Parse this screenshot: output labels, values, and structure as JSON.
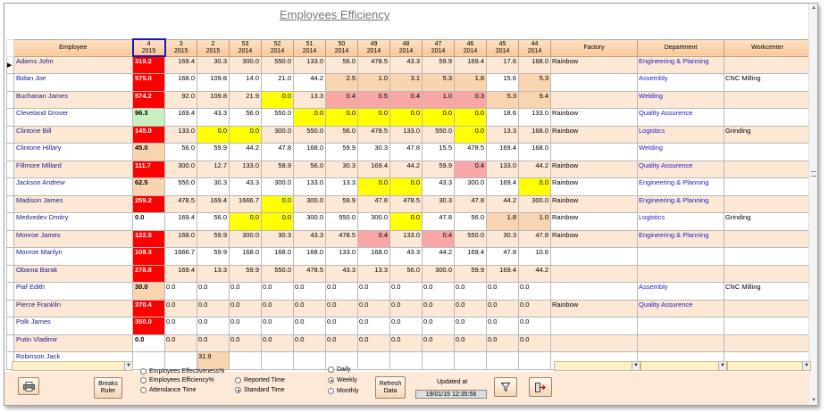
{
  "title": "Employees Efficiency",
  "columns": {
    "employee": "Employee",
    "weeks": [
      {
        "week": "4",
        "year": "2015"
      },
      {
        "week": "3",
        "year": "2015"
      },
      {
        "week": "2",
        "year": "2015"
      },
      {
        "week": "53",
        "year": "2014"
      },
      {
        "week": "52",
        "year": "2014"
      },
      {
        "week": "51",
        "year": "2014"
      },
      {
        "week": "50",
        "year": "2014"
      },
      {
        "week": "49",
        "year": "2014"
      },
      {
        "week": "48",
        "year": "2014"
      },
      {
        "week": "47",
        "year": "2014"
      },
      {
        "week": "46",
        "year": "2014"
      },
      {
        "week": "45",
        "year": "2014"
      },
      {
        "week": "44",
        "year": "2014"
      }
    ],
    "factory": "Factory",
    "department": "Department",
    "workcenter": "Workcenter"
  },
  "rows": [
    {
      "name": "Adams John",
      "v": [
        "319.2",
        "169.4",
        "30.3",
        "300.0",
        "550.0",
        "133.0",
        "56.0",
        "478.5",
        "43.3",
        "59.9",
        "169.4",
        "17.6",
        "168.0"
      ],
      "c": [
        "red",
        "",
        "",
        "",
        "",
        "",
        "",
        "",
        "",
        "",
        "",
        "",
        ""
      ],
      "factory": "Rainbow",
      "department": "Engineering & Planning",
      "workcenter": ""
    },
    {
      "name": "Bidan Joe",
      "v": [
        "575.0",
        "168.0",
        "109.8",
        "14.0",
        "21.0",
        "44.2",
        "2.5",
        "1.0",
        "3.1",
        "5.3",
        "1.8",
        "15.6",
        "5.3"
      ],
      "c": [
        "red",
        "",
        "",
        "",
        "",
        "",
        "tan",
        "tan",
        "tan",
        "tan",
        "tan",
        "",
        "tan"
      ],
      "factory": "",
      "department": "Assembly",
      "workcenter": "CNC Milling"
    },
    {
      "name": "Buchanan James",
      "v": [
        "574.2",
        "92.0",
        "109.8",
        "21.9",
        "0.0",
        "13.3",
        "0.4",
        "0.5",
        "0.4",
        "1.0",
        "0.3",
        "5.3",
        "9.4"
      ],
      "c": [
        "red",
        "",
        "",
        "",
        "yel",
        "",
        "pink",
        "pink",
        "pink",
        "pink",
        "pink",
        "tan",
        "tan"
      ],
      "factory": "",
      "department": "Welding",
      "workcenter": ""
    },
    {
      "name": "Cleveland  Grover",
      "v": [
        "96.3",
        "169.4",
        "43.3",
        "56.0",
        "550.0",
        "0.0",
        "0.0",
        "0.0",
        "0.0",
        "0.0",
        "0.0",
        "18.6",
        "133.0"
      ],
      "c": [
        "green",
        "",
        "",
        "",
        "",
        "yel",
        "yel",
        "yel",
        "yel",
        "yel",
        "yel",
        "",
        ""
      ],
      "factory": "Rainbow",
      "department": "Quality Assurence",
      "workcenter": ""
    },
    {
      "name": "Clintone Bill",
      "v": [
        "145.0",
        "133.0",
        "0.0",
        "0.0",
        "300.0",
        "550.0",
        "56.0",
        "478.5",
        "133.0",
        "550.0",
        "0.0",
        "13.3",
        "168.0"
      ],
      "c": [
        "red",
        "",
        "yel",
        "yel",
        "",
        "",
        "",
        "",
        "",
        "",
        "yel",
        "",
        ""
      ],
      "factory": "Rainbow",
      "department": "Logistics",
      "workcenter": "Grinding"
    },
    {
      "name": "Clintone Hillary",
      "v": [
        "45.0",
        "56.0",
        "59.9",
        "44.2",
        "47.8",
        "168.0",
        "59.9",
        "30.3",
        "47.8",
        "15.5",
        "478.5",
        "169.4",
        "168.0"
      ],
      "c": [
        "tan",
        "",
        "",
        "",
        "",
        "",
        "",
        "",
        "",
        "",
        "",
        "",
        ""
      ],
      "factory": "",
      "department": "Welding",
      "workcenter": ""
    },
    {
      "name": "Fillmore  Millard",
      "v": [
        "111.7",
        "300.0",
        "12.7",
        "133.0",
        "59.9",
        "56.0",
        "30.3",
        "169.4",
        "44.2",
        "59.9",
        "0.4",
        "133.0",
        "44.2"
      ],
      "c": [
        "red",
        "",
        "",
        "",
        "",
        "",
        "",
        "",
        "",
        "",
        "pink",
        "",
        ""
      ],
      "factory": "Rainbow",
      "department": "Quality Assurence",
      "workcenter": ""
    },
    {
      "name": "Jackson  Andrew",
      "v": [
        "62.5",
        "550.0",
        "30.3",
        "43.3",
        "300.0",
        "133.0",
        "13.3",
        "0.0",
        "0.0",
        "43.3",
        "300.0",
        "169.4",
        "0.0"
      ],
      "c": [
        "tan",
        "",
        "",
        "",
        "",
        "",
        "",
        "yel",
        "yel",
        "",
        "",
        "",
        "yel"
      ],
      "factory": "Rainbow",
      "department": "Engineering & Planning",
      "workcenter": ""
    },
    {
      "name": "Madison James",
      "v": [
        "259.2",
        "478.5",
        "169.4",
        "1666.7",
        "0.0",
        "300.0",
        "59.9",
        "47.8",
        "478.5",
        "30.3",
        "47.8",
        "44.2",
        "300.0"
      ],
      "c": [
        "red",
        "",
        "",
        "",
        "yel",
        "",
        "",
        "",
        "",
        "",
        "",
        "",
        ""
      ],
      "factory": "Rainbow",
      "department": "Engineering & Planning",
      "workcenter": ""
    },
    {
      "name": "Medvedev Dmitry",
      "v": [
        "0.0",
        "169.4",
        "56.0",
        "0.0",
        "0.0",
        "300.0",
        "550.0",
        "300.0",
        "0.0",
        "47.8",
        "56.0",
        "1.8",
        "1.0"
      ],
      "c": [
        "",
        "",
        "",
        "yel",
        "yel",
        "",
        "",
        "",
        "yel",
        "",
        "",
        "tan",
        "tan"
      ],
      "factory": "Rainbow",
      "department": "Logistics",
      "workcenter": "Grinding"
    },
    {
      "name": "Monroe James",
      "v": [
        "122.5",
        "168.0",
        "59.9",
        "300.0",
        "30.3",
        "43.3",
        "478.5",
        "0.4",
        "133.0",
        "0.4",
        "550.0",
        "30.3",
        "47.8"
      ],
      "c": [
        "red",
        "",
        "",
        "",
        "",
        "",
        "",
        "pink",
        "",
        "pink",
        "",
        "",
        ""
      ],
      "factory": "Rainbow",
      "department": "Engineering & Planning",
      "workcenter": ""
    },
    {
      "name": "Monroe Marilyn",
      "v": [
        "108.3",
        "1666.7",
        "59.9",
        "168.0",
        "168.0",
        "168.0",
        "133.0",
        "168.0",
        "43.3",
        "44.2",
        "169.4",
        "47.8",
        "10.6"
      ],
      "c": [
        "red",
        "",
        "",
        "",
        "",
        "",
        "",
        "",
        "",
        "",
        "",
        "",
        ""
      ],
      "factory": "",
      "department": "",
      "workcenter": ""
    },
    {
      "name": "Obama Barak",
      "v": [
        "278.8",
        "169.4",
        "13.3",
        "59.9",
        "550.0",
        "478.5",
        "43.3",
        "13.3",
        "56.0",
        "300.0",
        "59.9",
        "169.4",
        "44.2"
      ],
      "c": [
        "red",
        "",
        "",
        "",
        "",
        "",
        "",
        "",
        "",
        "",
        "",
        "",
        ""
      ],
      "factory": "",
      "department": "",
      "workcenter": ""
    },
    {
      "name": "Piaf Edith",
      "v": [
        "30.0",
        "0.0",
        "0.0",
        "0.0",
        "0.0",
        "0.0",
        "0.0",
        "0.0",
        "0.0",
        "0.0",
        "0.0",
        "0.0",
        "0.0"
      ],
      "c": [
        "tan",
        "",
        "",
        "",
        "",
        "",
        "",
        "",
        "",
        "",
        "",
        "",
        ""
      ],
      "factory": "",
      "department": "Assembly",
      "workcenter": "CNC Milling"
    },
    {
      "name": "Pierce  Franklin",
      "v": [
        "370.4",
        "0.0",
        "0.0",
        "0.0",
        "0.0",
        "0.0",
        "0.0",
        "0.0",
        "0.0",
        "0.0",
        "0.0",
        "0.0",
        "0.0"
      ],
      "c": [
        "red",
        "",
        "",
        "",
        "",
        "",
        "",
        "",
        "",
        "",
        "",
        "",
        ""
      ],
      "factory": "Rainbow",
      "department": "Quality Assurence",
      "workcenter": ""
    },
    {
      "name": "Polk James",
      "v": [
        "350.0",
        "0.0",
        "0.0",
        "0.0",
        "0.0",
        "0.0",
        "0.0",
        "0.0",
        "0.0",
        "0.0",
        "0.0",
        "0.0",
        "0.0"
      ],
      "c": [
        "red",
        "",
        "",
        "",
        "",
        "",
        "",
        "",
        "",
        "",
        "",
        "",
        ""
      ],
      "factory": "",
      "department": "",
      "workcenter": ""
    },
    {
      "name": "Putin Vladimir",
      "v": [
        "0.0",
        "0.0",
        "0.0",
        "0.0",
        "0.0",
        "0.0",
        "0.0",
        "0.0",
        "0.0",
        "0.0",
        "0.0",
        "0.0",
        "0.0"
      ],
      "c": [
        "",
        "",
        "",
        "",
        "",
        "",
        "",
        "",
        "",
        "",
        "",
        "",
        ""
      ],
      "factory": "",
      "department": "",
      "workcenter": ""
    },
    {
      "name": "Robinson Jack",
      "v": [
        "",
        "",
        "31.9",
        "",
        "",
        "",
        "",
        "",
        "",
        "",
        "",
        "",
        ""
      ],
      "c": [
        "",
        "",
        "tan",
        "",
        "",
        "",
        "",
        "",
        "",
        "",
        "",
        "",
        ""
      ],
      "factory": "",
      "department": "",
      "workcenter": ""
    }
  ],
  "controls": {
    "breaks_ruler": "Breaks Ruler",
    "opt_effectiveness": "Employees Effectiveness%",
    "opt_efficiency": "Employees Efficiency%",
    "opt_attendance": "Attendance Time",
    "opt_reported": "Reported Time",
    "opt_standard": "Standard Time",
    "opt_daily": "Daily",
    "opt_weekly": "Weekly",
    "opt_monthly": "Monthly",
    "refresh_data": "Refresh Data",
    "updated_at_label": "Updated at",
    "updated_at_value": "19/01/15 12:35:56"
  },
  "colors": {
    "red": "#ff0000",
    "yellow": "#ffff00",
    "pink": "#f8a6a6",
    "tan": "#f8d4b0",
    "green": "#c8f0c0",
    "header_bg": "#f8c79a",
    "alt_row": "#fde8d6"
  },
  "icons": [
    "print-icon",
    "filter-icon",
    "exit-icon",
    "row-pointer-icon",
    "chevron-down-icon"
  ]
}
